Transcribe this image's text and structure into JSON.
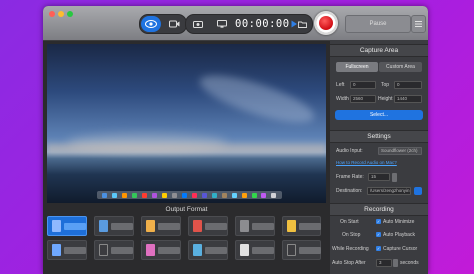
{
  "toolbar": {
    "timer": "00:00:00",
    "right_button_label": "Pause"
  },
  "output_format": {
    "title": "Output Format"
  },
  "capture_area": {
    "title": "Capture Area",
    "modes": [
      "Fullscreen",
      "Custom Area"
    ],
    "active_mode": "Fullscreen",
    "left_label": "Left",
    "left_value": "0",
    "top_label": "Top",
    "top_value": "0",
    "width_label": "Width",
    "width_value": "2560",
    "height_label": "Height",
    "height_value": "1440",
    "select_button": "Select..."
  },
  "settings": {
    "title": "Settings",
    "audio_input_label": "Audio Input:",
    "audio_input_value": "Soundflower (2ch)",
    "help_link": "How to Record Audio on Mac?",
    "frame_rate_label": "Frame Rate:",
    "frame_rate_value": "15",
    "destination_label": "Destination:",
    "destination_value": "/Users/zengzhonyin"
  },
  "recording": {
    "title": "Recording",
    "on_start_label": "On Start",
    "on_start_option": "Auto Minimize",
    "on_stop_label": "On Stop",
    "on_stop_option": "Auto Playback",
    "while_recording_label": "While Recording",
    "while_recording_option": "Capture Cursor",
    "auto_stop_label": "Auto Stop After",
    "auto_stop_value": "3",
    "auto_stop_unit": "seconds"
  },
  "colors": {
    "background_purple": "#a61fe0",
    "accent_blue": "#1f73e0",
    "record_red": "#d00c14"
  }
}
